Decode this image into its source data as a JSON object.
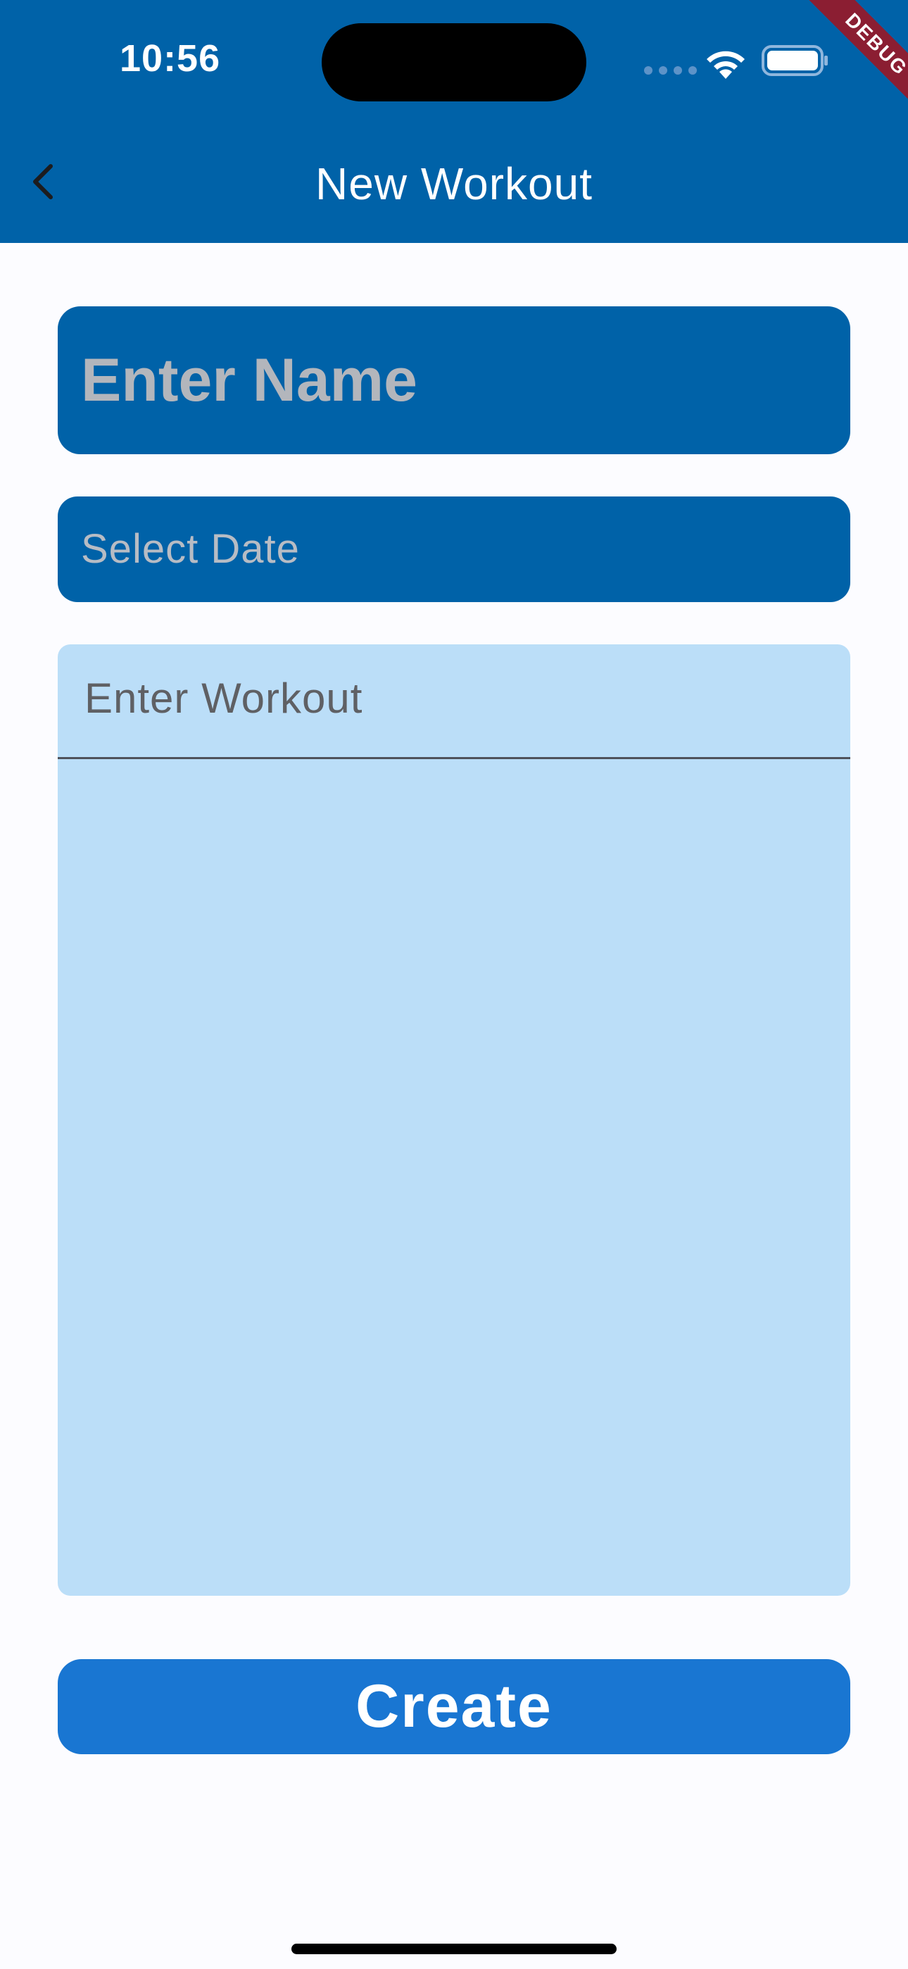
{
  "status_bar": {
    "time": "10:56"
  },
  "debug_banner": "DEBUG",
  "app_bar": {
    "title": "New Workout",
    "back_icon": "chevron-left-icon"
  },
  "form": {
    "name_placeholder": "Enter Name",
    "date_placeholder": "Select Date",
    "workout_placeholder": "Enter Workout"
  },
  "actions": {
    "create_label": "Create"
  },
  "colors": {
    "primary": "#0062a8",
    "button": "#1976d2",
    "workout_field_bg": "#bbdef8",
    "debug_ribbon": "#8b1e32"
  }
}
